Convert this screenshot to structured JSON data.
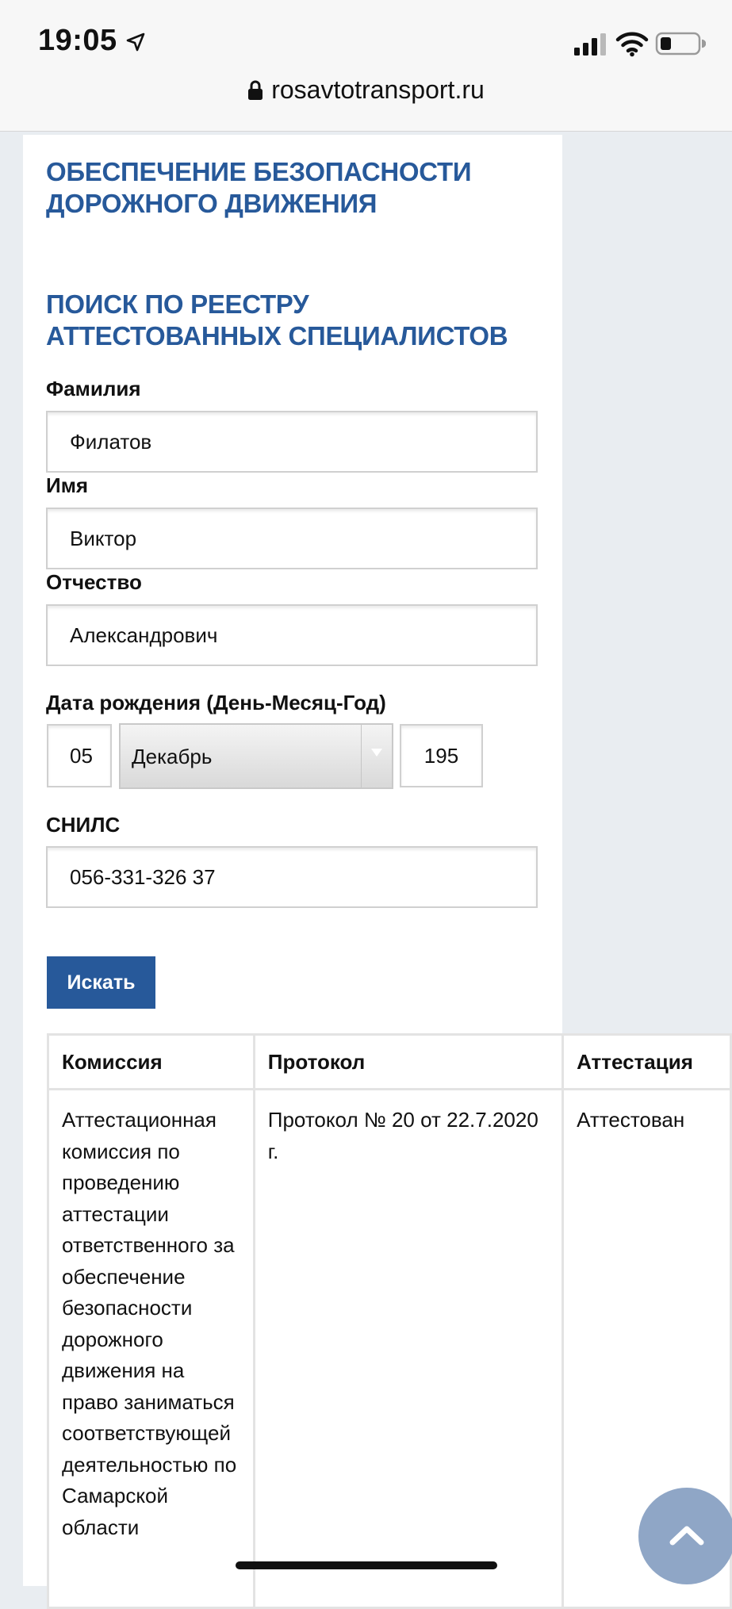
{
  "status_bar": {
    "time": "19:05",
    "url": "rosavtotransport.ru"
  },
  "page": {
    "section_title": "ОБЕСПЕЧЕНИЕ БЕЗОПАСНОСТИ ДОРОЖНОГО ДВИЖЕНИЯ",
    "search_title": "ПОИСК ПО РЕЕСТРУ АТТЕСТОВАННЫХ СПЕЦИАЛИСТОВ"
  },
  "form": {
    "surname_label": "Фамилия",
    "surname_value": "Филатов",
    "name_label": "Имя",
    "name_value": "Виктор",
    "patronymic_label": "Отчество",
    "patronymic_value": "Александрович",
    "birthdate_label": "Дата рождения (День-Месяц-Год)",
    "birth_day": "05",
    "birth_month": "Декабрь",
    "birth_year": "195",
    "snils_label": "СНИЛС",
    "snils_value": "056-331-326 37",
    "search_button": "Искать"
  },
  "table": {
    "headers": [
      "Комиссия",
      "Протокол",
      "Аттестация"
    ],
    "rows": [
      {
        "commission": "Аттестационная комиссия по проведению аттестации ответственного за обеспечение безопасности дорожного движения на право заниматься соответствующей деятельностью по Самарской области",
        "protocol": "Протокол № 20 от 22.7.2020 г.",
        "status": "Аттестован"
      }
    ]
  },
  "icons": {
    "location_arrow": "location-arrow-icon",
    "signal": "cellular-signal-icon",
    "wifi": "wifi-icon",
    "battery": "battery-icon",
    "lock": "lock-icon",
    "scroll_top": "chevron-up-icon"
  },
  "colors": {
    "accent": "#27599a",
    "scroll_button": "#8fa6c6"
  }
}
